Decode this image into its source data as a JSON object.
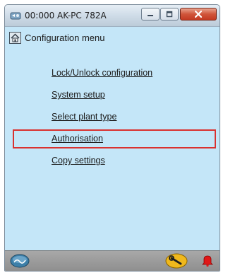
{
  "window": {
    "title": "00:000 AK-PC 782A"
  },
  "header": {
    "title": "Configuration menu",
    "icon": "house-icon"
  },
  "menu": {
    "items": [
      {
        "label": "Lock/Unlock configuration"
      },
      {
        "label": "System setup"
      },
      {
        "label": "Select plant type"
      },
      {
        "label": "Authorisation",
        "highlighted": true
      },
      {
        "label": "Copy settings"
      }
    ]
  },
  "statusbar": {
    "left_icon": "online-status-icon",
    "wrench_icon": "wrench-icon",
    "alarm_icon": "alarm-bell-icon"
  },
  "colors": {
    "content_background": "#c4e6f8",
    "highlight_border": "#d9312f",
    "close_button": "#c33a22"
  }
}
